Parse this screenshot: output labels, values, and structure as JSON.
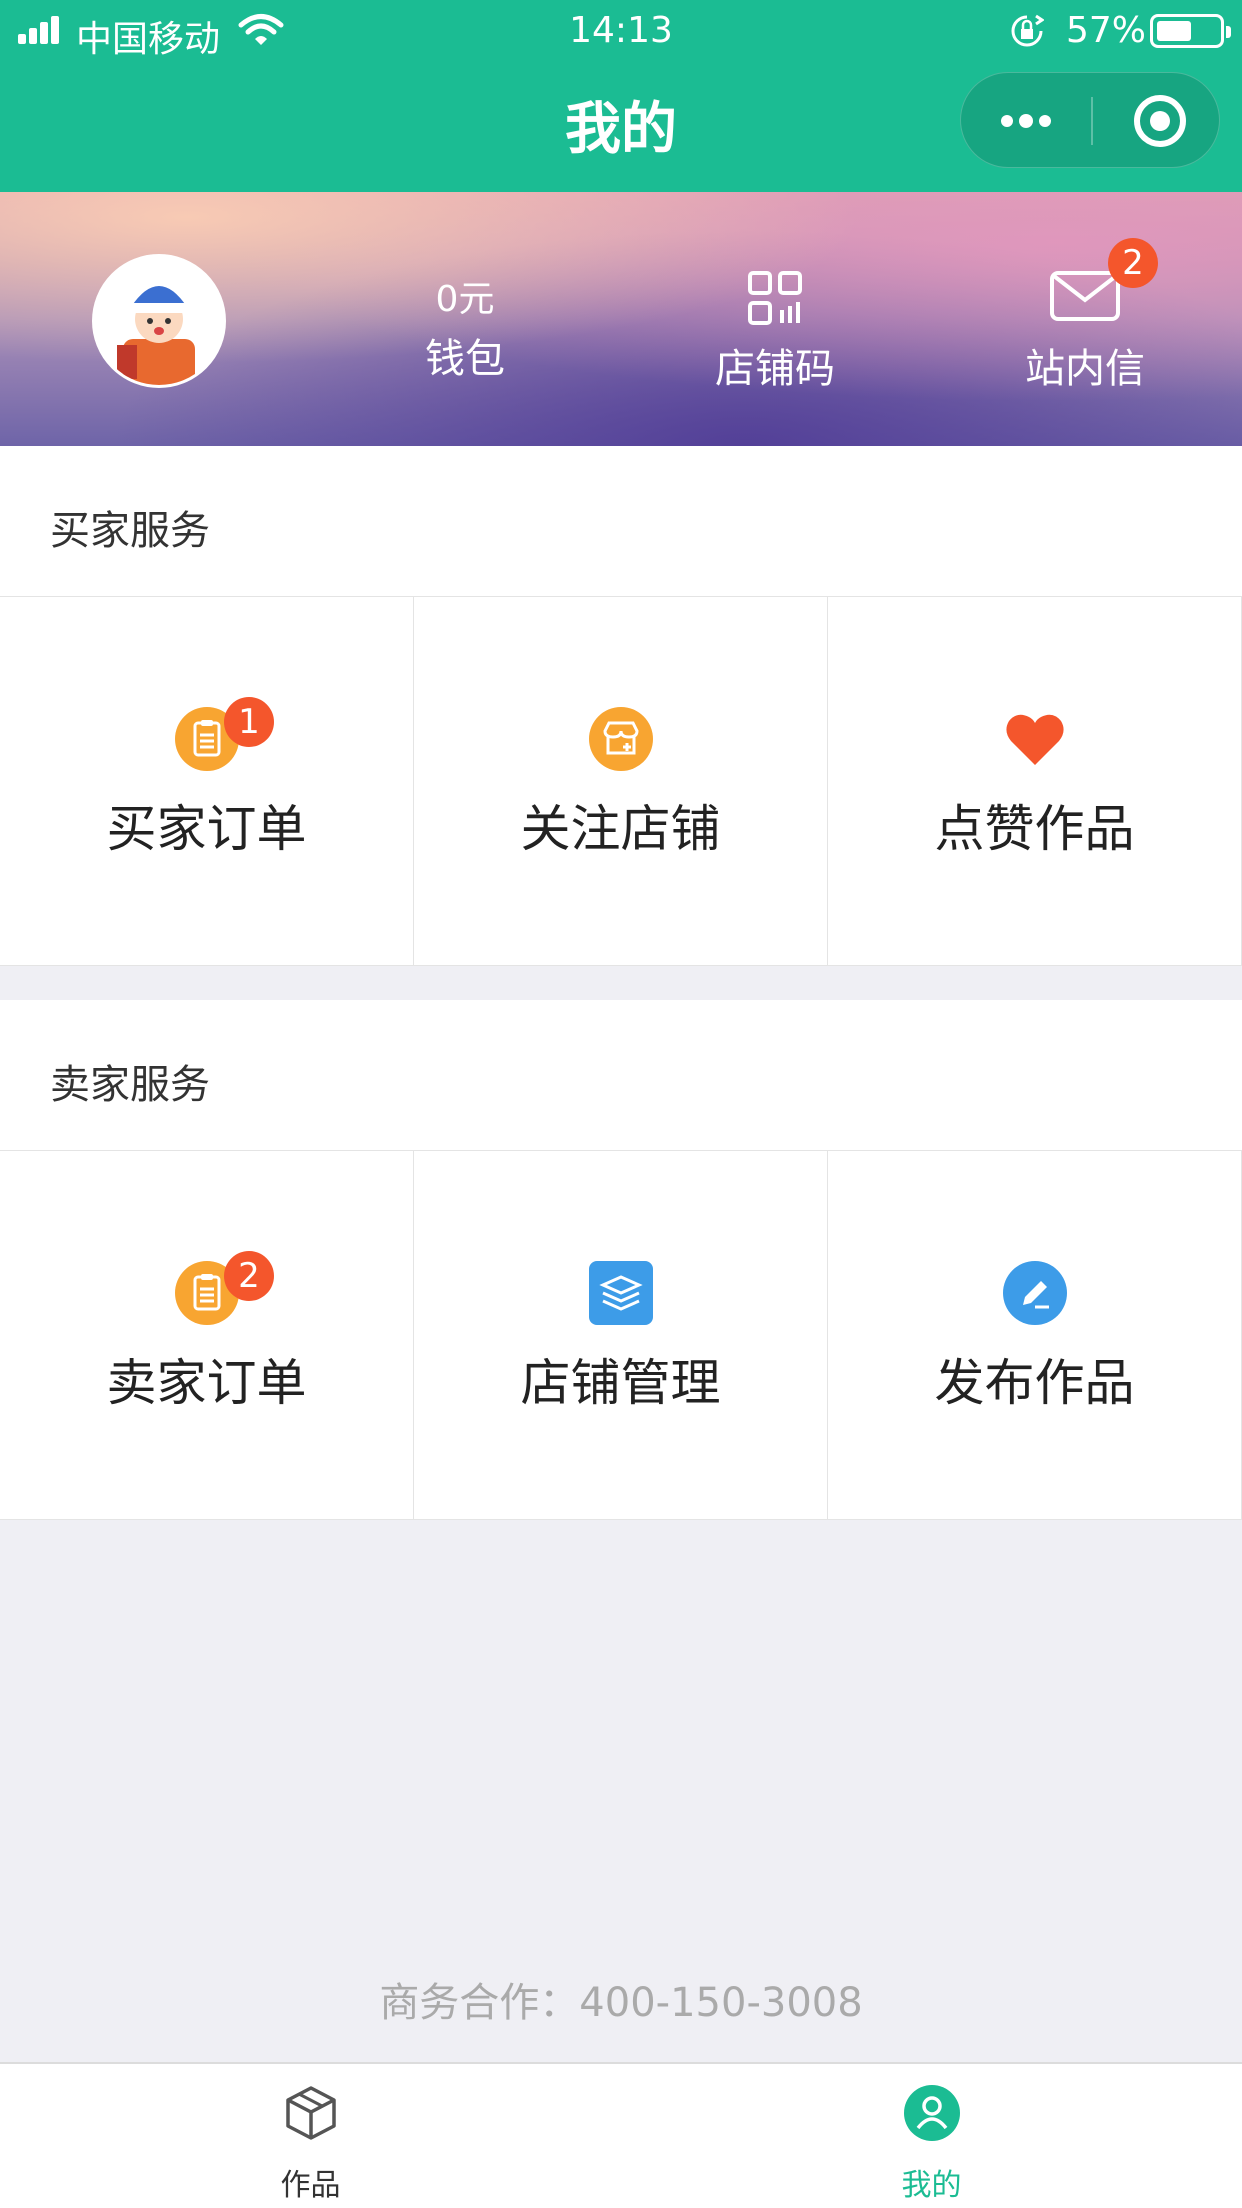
{
  "status_bar": {
    "carrier": "中国移动",
    "time": "14:13",
    "battery_percent": "57%",
    "battery_level": 0.57
  },
  "nav": {
    "title": "我的",
    "more_icon": "more-dots-icon",
    "close_icon": "target-close-icon"
  },
  "profile": {
    "wallet_value": "0元",
    "wallet_label": "钱包",
    "qr_label": "店铺码",
    "mail_label": "站内信",
    "mail_badge": "2"
  },
  "buyer": {
    "title": "买家服务",
    "items": [
      {
        "label": "买家订单",
        "icon": "clipboard-icon",
        "badge": "1",
        "color": "#f8a531"
      },
      {
        "label": "关注店铺",
        "icon": "store-icon",
        "badge": "",
        "color": "#f8a531"
      },
      {
        "label": "点赞作品",
        "icon": "heart-icon",
        "badge": "",
        "color": "#f4562c"
      }
    ]
  },
  "seller": {
    "title": "卖家服务",
    "items": [
      {
        "label": "卖家订单",
        "icon": "clipboard-icon",
        "badge": "2",
        "color": "#f8a531"
      },
      {
        "label": "店铺管理",
        "icon": "layers-icon",
        "badge": "",
        "color": "#3d9ce8"
      },
      {
        "label": "发布作品",
        "icon": "pencil-icon",
        "badge": "",
        "color": "#3d9ce8"
      }
    ]
  },
  "footer": {
    "contact": "商务合作：400-150-3008"
  },
  "tabbar": {
    "tabs": [
      {
        "label": "作品",
        "icon": "cube-icon",
        "active": false
      },
      {
        "label": "我的",
        "icon": "user-icon",
        "active": true
      }
    ]
  },
  "colors": {
    "brand": "#1bbc93",
    "badge": "#f4562c",
    "orange": "#f8a531",
    "blue": "#3d9ce8"
  }
}
